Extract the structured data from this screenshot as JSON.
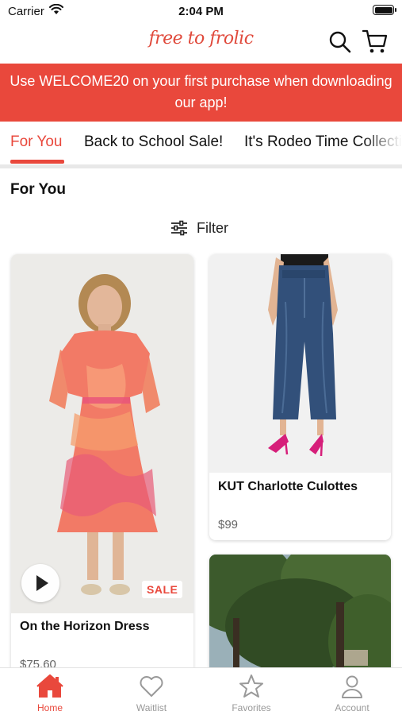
{
  "status_bar": {
    "carrier": "Carrier",
    "time": "2:04 PM"
  },
  "header": {
    "logo_text": "free to frolic"
  },
  "promo": {
    "text": "Use WELCOME20 on your first purchase when downloading our app!"
  },
  "tabs": [
    {
      "label": "For You",
      "active": true
    },
    {
      "label": "Back to School Sale!",
      "active": false
    },
    {
      "label": "It's Rodeo Time Collection",
      "active": false
    }
  ],
  "section": {
    "title": "For You"
  },
  "filter": {
    "label": "Filter"
  },
  "products": [
    {
      "name": "On the Horizon Dress",
      "price": "$75.60",
      "badge": "SALE",
      "has_video": true
    },
    {
      "name": "KUT Charlotte Culottes",
      "price": "$99"
    },
    {
      "name": "",
      "price": ""
    }
  ],
  "tabbar": [
    {
      "label": "Home",
      "icon": "home-icon",
      "active": true
    },
    {
      "label": "Waitlist",
      "icon": "heart-icon",
      "active": false
    },
    {
      "label": "Favorites",
      "icon": "star-icon",
      "active": false
    },
    {
      "label": "Account",
      "icon": "person-icon",
      "active": false
    }
  ],
  "colors": {
    "accent": "#e9483c",
    "inactive": "#999999"
  }
}
